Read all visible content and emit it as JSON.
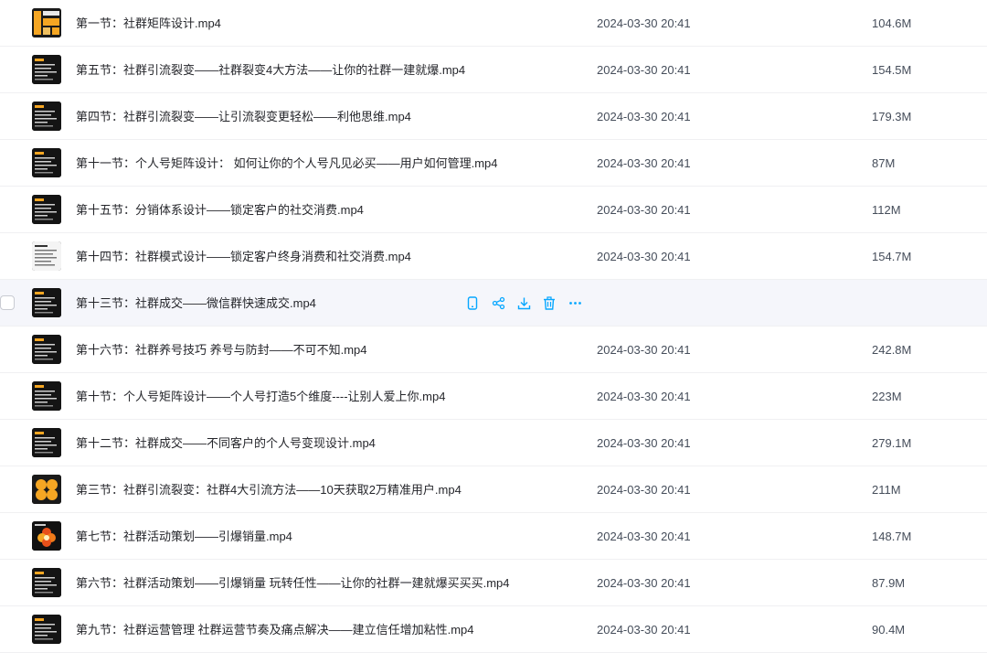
{
  "colors": {
    "accent": "#06a7ff",
    "hover_row": "#f5f6fb",
    "thumb_bg": "#141414",
    "thumb_orange": "#f5a623"
  },
  "row_actions": [
    "phone-icon",
    "share-icon",
    "download-icon",
    "delete-icon",
    "more-icon"
  ],
  "files": [
    {
      "name": "第一节：社群矩阵设计.mp4",
      "date": "2024-03-30 20:41",
      "size": "104.6M",
      "thumb": "orange-blocks"
    },
    {
      "name": "第五节：社群引流裂变——社群裂变4大方法——让你的社群一建就爆.mp4",
      "date": "2024-03-30 20:41",
      "size": "154.5M",
      "thumb": "dark-text"
    },
    {
      "name": "第四节：社群引流裂变——让引流裂变更轻松——利他思维.mp4",
      "date": "2024-03-30 20:41",
      "size": "179.3M",
      "thumb": "dark-text"
    },
    {
      "name": "第十一节：个人号矩阵设计： 如何让你的个人号凡见必买——用户如何管理.mp4",
      "date": "2024-03-30 20:41",
      "size": "87M",
      "thumb": "dark-text"
    },
    {
      "name": "第十五节：分销体系设计——锁定客户的社交消费.mp4",
      "date": "2024-03-30 20:41",
      "size": "112M",
      "thumb": "dark-text"
    },
    {
      "name": "第十四节：社群模式设计——锁定客户终身消费和社交消费.mp4",
      "date": "2024-03-30 20:41",
      "size": "154.7M",
      "thumb": "light-doc"
    },
    {
      "name": "第十三节：社群成交——微信群快速成交.mp4",
      "date": "",
      "size": "",
      "thumb": "dark-text",
      "hover": true
    },
    {
      "name": "第十六节：社群养号技巧 养号与防封——不可不知.mp4",
      "date": "2024-03-30 20:41",
      "size": "242.8M",
      "thumb": "dark-text"
    },
    {
      "name": "第十节：个人号矩阵设计——个人号打造5个维度----让别人爱上你.mp4",
      "date": "2024-03-30 20:41",
      "size": "223M",
      "thumb": "dark-text"
    },
    {
      "name": "第十二节：社群成交——不同客户的个人号变现设计.mp4",
      "date": "2024-03-30 20:41",
      "size": "279.1M",
      "thumb": "dark-text"
    },
    {
      "name": "第三节：社群引流裂变：社群4大引流方法——10天获取2万精准用户.mp4",
      "date": "2024-03-30 20:41",
      "size": "211M",
      "thumb": "orange-circles"
    },
    {
      "name": "第七节：社群活动策划——引爆销量.mp4",
      "date": "2024-03-30 20:41",
      "size": "148.7M",
      "thumb": "flower"
    },
    {
      "name": "第六节：社群活动策划——引爆销量 玩转任性——让你的社群一建就爆买买买.mp4",
      "date": "2024-03-30 20:41",
      "size": "87.9M",
      "thumb": "dark-text"
    },
    {
      "name": "第九节：社群运营管理 社群运营节奏及痛点解决——建立信任增加粘性.mp4",
      "date": "2024-03-30 20:41",
      "size": "90.4M",
      "thumb": "dark-text"
    }
  ]
}
